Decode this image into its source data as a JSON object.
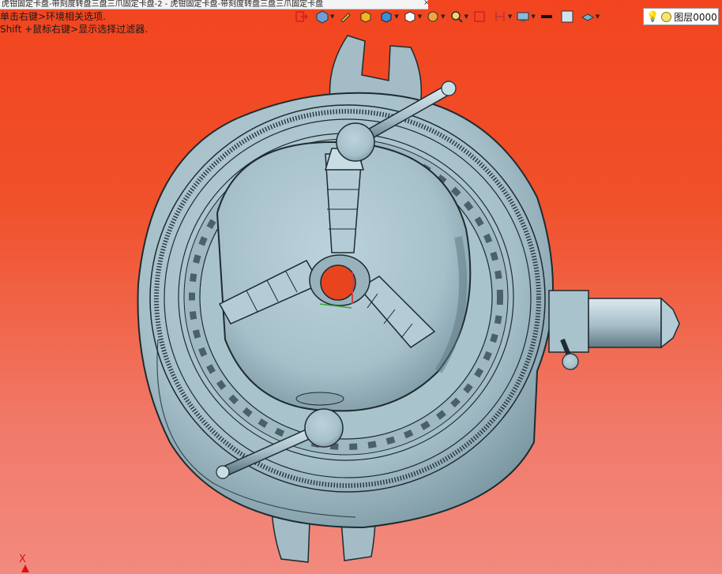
{
  "document_tab": {
    "title": "虎钳固定卡盘-带刻度转盘三盘三爪固定卡盘-2 - 虎钳固定卡盘-带刻度转盘三盘三爪固定卡盘",
    "close_label": "×"
  },
  "hints": {
    "line1": "单击右键>环境相关选项.",
    "line2": "Shift +鼠标右键>显示选择过滤器."
  },
  "toolbar": {
    "icons": [
      "exit-view-icon",
      "view-orientation-icon",
      "pencil-icon",
      "shaded-cube-icon",
      "render-mode-icon",
      "wireframe-cube-icon",
      "clip-icon",
      "zoom-icon",
      "section-icon",
      "dimension-icon",
      "display-settings-icon",
      "line-color-icon",
      "fill-color-icon",
      "layer-color-icon"
    ]
  },
  "layer": {
    "label": "图层0000",
    "bulb_icon": "lightbulb-icon"
  },
  "axis": {
    "x_label": "X"
  },
  "colors": {
    "viewport_top": "#f2451f",
    "viewport_bottom": "#f28a7e",
    "model_steel": "#a9c3cd",
    "model_edge": "#1e2b30"
  }
}
